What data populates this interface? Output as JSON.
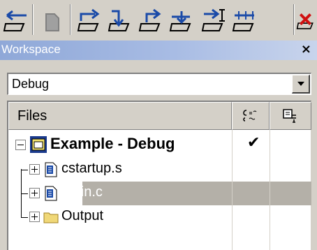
{
  "toolbar": {
    "buttons": [
      {
        "name": "step-out-icon"
      },
      {
        "name": "breakpoint-icon"
      },
      {
        "name": "step-over-icon"
      },
      {
        "name": "step-into-icon"
      },
      {
        "name": "next-statement-icon"
      },
      {
        "name": "run-to-cursor-icon"
      },
      {
        "name": "step-over-line-icon"
      },
      {
        "name": "auto-step-icon"
      },
      {
        "name": "stop-debugging-icon"
      }
    ]
  },
  "workspace": {
    "title": "Workspace",
    "close_glyph": "×",
    "configuration": "Debug"
  },
  "files": {
    "header": "Files",
    "tree": [
      {
        "label": "Example - Debug",
        "type": "project",
        "checked": true
      },
      {
        "label": "cstartup.s",
        "type": "file"
      },
      {
        "label": "main.c",
        "type": "file",
        "selected": true
      },
      {
        "label": "Output",
        "type": "folder"
      }
    ],
    "check_glyph": "✔"
  },
  "colors": {
    "titlebar": "#a8bce4",
    "selection": "#b4b0a8",
    "face": "#d4d0c8"
  }
}
